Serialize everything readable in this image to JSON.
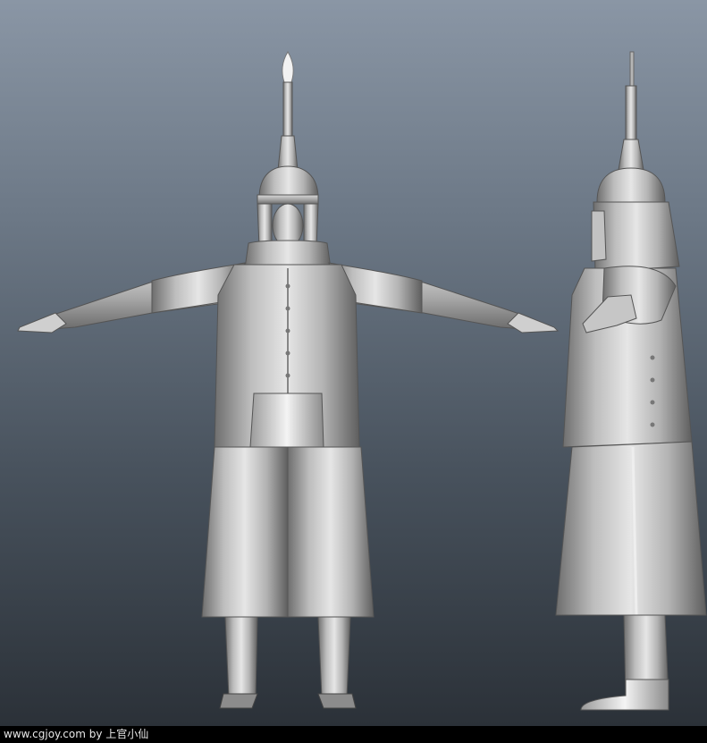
{
  "viewport": {
    "background_top": "#8a96a5",
    "background_bottom": "#2b3138",
    "model_color": "#b9b9b9"
  },
  "views": [
    {
      "name": "front"
    },
    {
      "name": "side"
    }
  ],
  "watermark": {
    "text": "www.cgjoy.com by 上官小仙"
  }
}
